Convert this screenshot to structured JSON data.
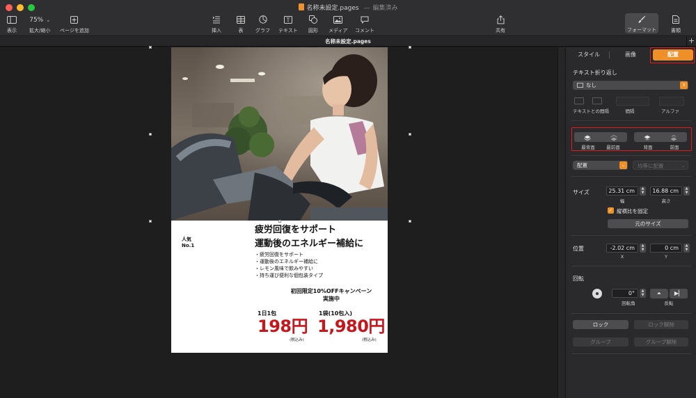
{
  "window": {
    "title": "名称未設定.pages",
    "title_separator": "—",
    "status": "編集済み",
    "traffic_colors": [
      "#fe5f57",
      "#febc2e",
      "#28c840"
    ]
  },
  "toolbar": {
    "view_label": "表示",
    "zoom_value": "75%",
    "zoom_label": "拡大/縮小",
    "add_page_label": "ページを追加",
    "insert_label": "挿入",
    "table_label": "表",
    "chart_label": "グラフ",
    "text_label": "テキスト",
    "shape_label": "図形",
    "media_label": "メディア",
    "comment_label": "コメント",
    "share_label": "共有",
    "format_label": "フォーマット",
    "document_label": "書類"
  },
  "tabbar": {
    "title": "名称未設定.pages",
    "add": "+"
  },
  "ad": {
    "popular_line1": "人気",
    "popular_line2": "No.1",
    "headline_line1": "疲労回復をサポート",
    "headline_line2": "運動後のエネルギー補給に",
    "bullets": [
      "疲労回復をサポート",
      "運動後のエネルギー補給に",
      "レモン風味で飲みやすい",
      "持ち運び便利な個包装タイプ"
    ],
    "campaign_line1": "初回限定10%OFFキャンペーン",
    "campaign_line2": "実施中",
    "offer1_label": "1日1包",
    "offer1_price": "198円",
    "offer1_tax": "(税込み)",
    "offer2_label": "1袋(10包入)",
    "offer2_price": "1,980円",
    "offer2_tax": "(税込み)",
    "price_color": "#c8161d"
  },
  "inspector": {
    "tabs": [
      "スタイル",
      "画像",
      "配置"
    ],
    "active_tab": "配置",
    "accent_color": "#ef8f27",
    "highlight_color": "#e01c1c",
    "text_wrap_label": "テキスト折り返し",
    "text_wrap_value": "なし",
    "spacing_label": "テキストとの間隔",
    "gap_label": "間隔",
    "alpha_label": "アルファ",
    "layer_buttons": {
      "back_most": "最背面",
      "front_most": "最前面",
      "back": "背面",
      "front": "前面"
    },
    "align_value": "配置",
    "distribute_value": "均等に配置",
    "size_label": "サイズ",
    "width_value": "25.31 cm",
    "width_label": "幅",
    "height_value": "16.88 cm",
    "height_label": "高さ",
    "constrain_label": "縦横比を固定",
    "constrain_checked": true,
    "original_size_label": "元のサイズ",
    "position_label": "位置",
    "x_value": "-2.02 cm",
    "x_label": "X",
    "y_value": "0 cm",
    "y_label": "Y",
    "rotate_label": "回転",
    "angle_value": "0°",
    "angle_label": "回転角",
    "flip_label": "反転",
    "lock_label": "ロック",
    "unlock_label": "ロック解除",
    "group_label": "グループ",
    "ungroup_label": "グループ解除"
  }
}
